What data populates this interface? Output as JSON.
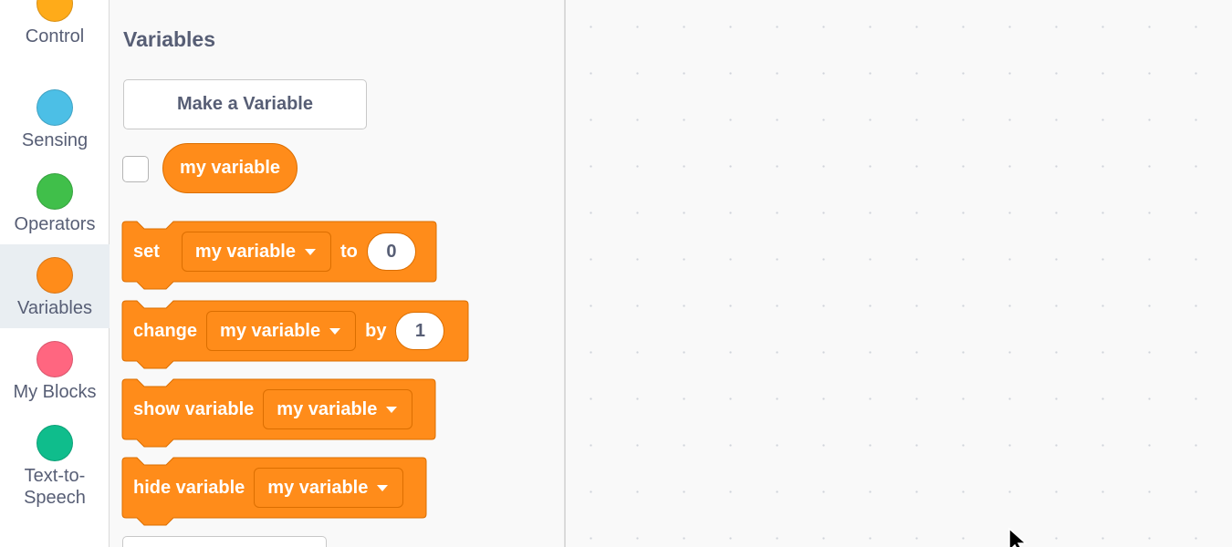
{
  "categories": [
    {
      "label": "Control",
      "color": "#ffab19"
    },
    {
      "label": "Sensing",
      "color": "#4cbfe6"
    },
    {
      "label": "Operators",
      "color": "#40bf4a"
    },
    {
      "label": "Variables",
      "color": "#ff8c1a",
      "selected": true
    },
    {
      "label": "My Blocks",
      "color": "#ff6680"
    },
    {
      "label": "Text-to-\nSpeech",
      "color": "#0fbd8c"
    }
  ],
  "palette": {
    "title": "Variables",
    "make_variable_label": "Make a Variable",
    "reporter_label": "my variable",
    "blocks": {
      "set": {
        "keyword": "set",
        "variable": "my variable",
        "connector": "to",
        "value": "0"
      },
      "change": {
        "keyword": "change",
        "variable": "my variable",
        "connector": "by",
        "value": "1"
      },
      "show": {
        "keyword": "show variable",
        "variable": "my variable"
      },
      "hide": {
        "keyword": "hide variable",
        "variable": "my variable"
      }
    }
  },
  "colors": {
    "block_fill": "#ff8c1a",
    "block_border": "#db6e00",
    "text_muted": "#575e75"
  }
}
